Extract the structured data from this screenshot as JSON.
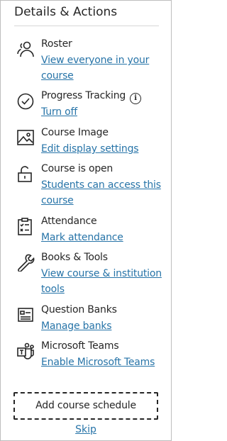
{
  "panel": {
    "title": "Details & Actions"
  },
  "items": [
    {
      "label": "Roster",
      "link": "View everyone in your course",
      "icon": "roster-icon"
    },
    {
      "label": "Progress Tracking",
      "link": "Turn off",
      "icon": "progress-check-icon",
      "info_icon": "i"
    },
    {
      "label": "Course Image",
      "link": "Edit display settings",
      "icon": "image-icon"
    },
    {
      "label": "Course is open",
      "link": "Students can access this course",
      "icon": "unlock-icon"
    },
    {
      "label": "Attendance",
      "link": "Mark attendance",
      "icon": "attendance-clipboard-icon"
    },
    {
      "label": "Books & Tools",
      "link": "View course & institution tools",
      "icon": "wrench-icon"
    },
    {
      "label": "Question Banks",
      "link": "Manage banks",
      "icon": "question-banks-icon"
    },
    {
      "label": "Microsoft Teams",
      "link": "Enable Microsoft Teams",
      "icon": "teams-icon"
    }
  ],
  "actions": {
    "schedule_label": "Add course schedule",
    "skip_label": "Skip"
  },
  "colors": {
    "link": "#2774a8",
    "text": "#262626",
    "border": "#bdbdbd"
  }
}
